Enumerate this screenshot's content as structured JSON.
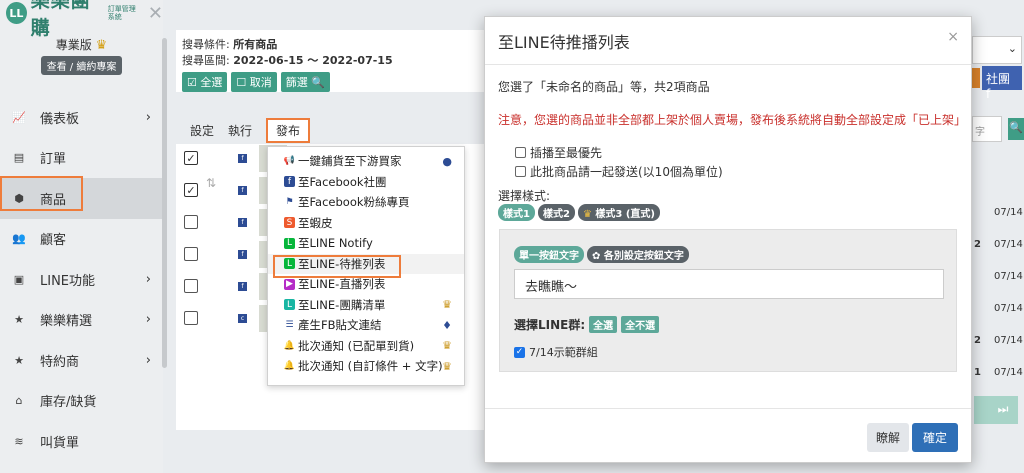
{
  "logo": {
    "badge": "LL",
    "name": "樂樂團購",
    "sub": "訂單管理系統"
  },
  "plan": {
    "name": "專業版",
    "renew": "查看 / 續約專案"
  },
  "nav": [
    {
      "label": "儀表板",
      "icon": "chart-icon",
      "chev": "›"
    },
    {
      "label": "訂單",
      "icon": "list-icon",
      "chev": ""
    },
    {
      "label": "商品",
      "icon": "box-icon",
      "chev": ""
    },
    {
      "label": "顧客",
      "icon": "users-icon",
      "chev": ""
    },
    {
      "label": "LINE功能",
      "icon": "line-icon",
      "chev": "›"
    },
    {
      "label": "樂樂精選",
      "icon": "star-icon",
      "chev": "›"
    },
    {
      "label": "特約商",
      "icon": "star-icon",
      "chev": "›"
    },
    {
      "label": "庫存/缺貨",
      "icon": "warehouse-icon",
      "chev": ""
    },
    {
      "label": "叫貨單",
      "icon": "stack-icon",
      "chev": ""
    }
  ],
  "filter": {
    "cond_label": "搜尋條件:",
    "cond_value": "所有商品",
    "range_label": "搜尋區間:",
    "range_value": "2022-06-15 ～ 2022-07-15",
    "select_all": "全選",
    "cancel": "取消",
    "filter": "篩選"
  },
  "tabs": {
    "settings": "設定",
    "execute": "執行",
    "publish": "發布"
  },
  "publish_menu": [
    {
      "label": "一鍵鋪貨至下游買家",
      "icon": "megaphone-icon",
      "color": "#2d4c94",
      "right": "●"
    },
    {
      "label": "至Facebook社團",
      "icon": "facebook-icon",
      "color": "#2d4c94",
      "right": ""
    },
    {
      "label": "至Facebook粉絲專頁",
      "icon": "flag-icon",
      "color": "#2d4c94",
      "right": ""
    },
    {
      "label": "至蝦皮",
      "icon": "shopee-icon",
      "color": "#ee5a2e",
      "right": ""
    },
    {
      "label": "至LINE Notify",
      "icon": "line-icon",
      "color": "#06b63b",
      "right": ""
    },
    {
      "label": "至LINE-待推列表",
      "icon": "line-icon",
      "color": "#06b63b",
      "right": ""
    },
    {
      "label": "至LINE-直播列表",
      "icon": "video-icon",
      "color": "#b52cc7",
      "right": ""
    },
    {
      "label": "至LINE-團購清單",
      "icon": "line-icon",
      "color": "#18b6a3",
      "right": "♛"
    },
    {
      "label": "產生FB貼文連結",
      "icon": "list-icon",
      "color": "#2d4c94",
      "right": "♦"
    },
    {
      "label": "批次通知 (已配單到貨)",
      "icon": "bell-icon",
      "color": "#06b63b",
      "right": "♛"
    },
    {
      "label": "批次通知 (自訂條件 + 文字)",
      "icon": "bell-icon",
      "color": "#06b63b",
      "right": "♛"
    }
  ],
  "rows": [
    {
      "checked": true,
      "tag": "f",
      "date": "07/14",
      "extra": ""
    },
    {
      "checked": true,
      "tag": "f",
      "date": "07/14",
      "extra": "2"
    },
    {
      "checked": false,
      "tag": "f",
      "date": "07/14",
      "extra": ""
    },
    {
      "checked": false,
      "tag": "f",
      "date": "07/14",
      "extra": ""
    },
    {
      "checked": false,
      "tag": "f",
      "date": "07/14",
      "extra": "2"
    },
    {
      "checked": false,
      "tag": "c",
      "date": "07/14",
      "extra": "1"
    }
  ],
  "behind": {
    "group_btn": "社團",
    "search_ph": "字"
  },
  "modal": {
    "title": "至LINE待推播列表",
    "close": "×",
    "selected_info": "您選了「未命名的商品」等，共2項商品",
    "warning": "注意，您選的商品並非全部都上架於個人賣場，發布後系統將自動全部設定成「已上架」",
    "opt_priority": "插播至最優先",
    "opt_batch": "此批商品請一起發送(以10個為單位)",
    "style_label": "選擇樣式:",
    "styles": [
      "樣式1",
      "樣式2",
      "樣式3 (直式)"
    ],
    "btn_single": "單一按鈕文字",
    "btn_each": "各別設定按鈕文字",
    "message": "去瞧瞧～",
    "group_label": "選擇LINE群:",
    "select_all": "全選",
    "select_none": "全不選",
    "group_name": "7/14示範群組",
    "btn_cancel": "瞭解",
    "btn_ok": "確定"
  },
  "colors": {
    "accent": "#3f9d86",
    "highlight": "#ee7c3b",
    "primary": "#2e6fb7",
    "warning": "#c9302c"
  }
}
